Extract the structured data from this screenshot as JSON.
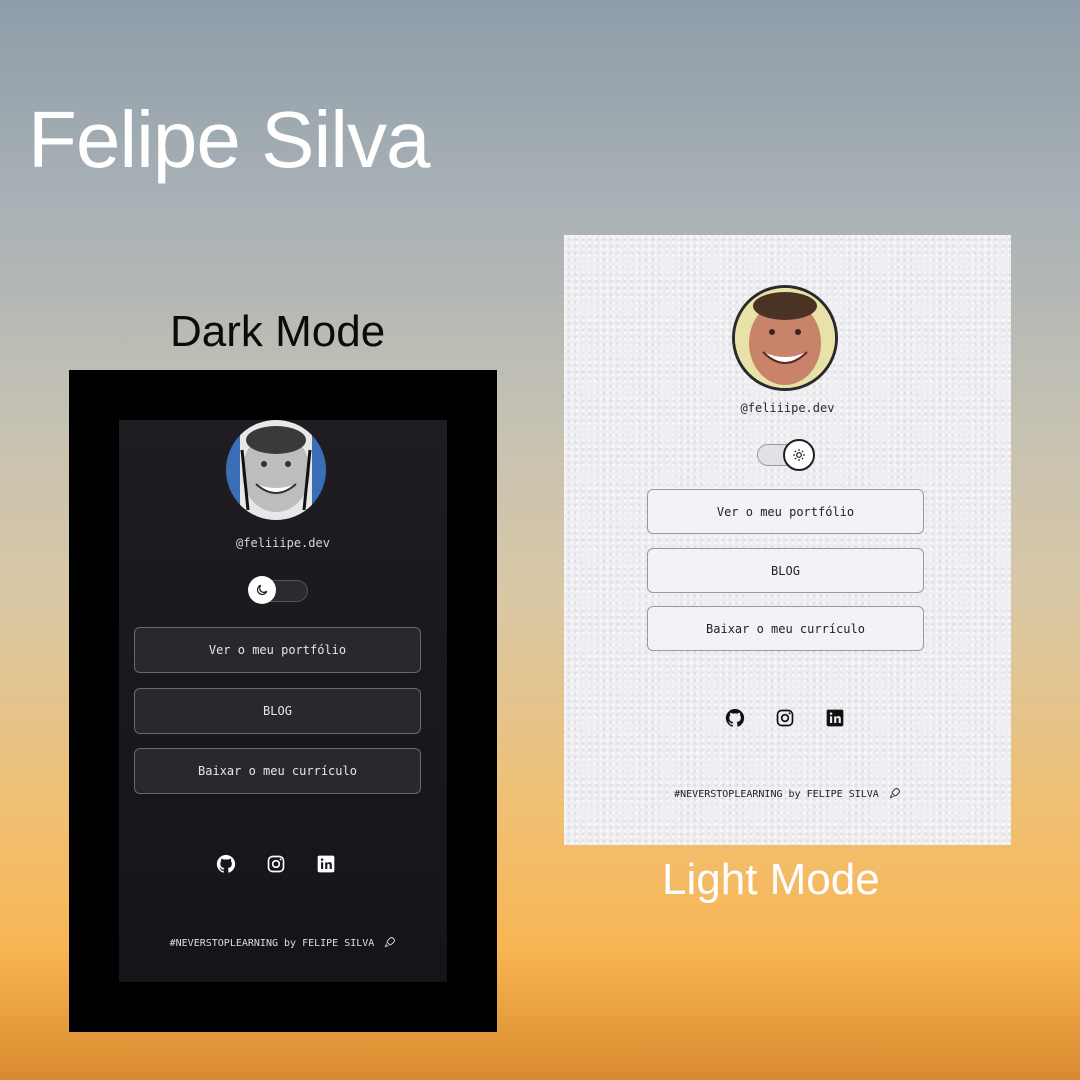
{
  "title": "Felipe Silva",
  "labels": {
    "dark": "Dark Mode",
    "light": "Light Mode"
  },
  "profile": {
    "handle": "@feliiipe.dev"
  },
  "buttons": {
    "portfolio": "Ver o meu portfólio",
    "blog": "BLOG",
    "resume": "Baixar o meu currículo"
  },
  "footer": "#NEVERSTOPLEARNING by FELIPE SILVA",
  "icons": [
    "github-icon",
    "instagram-icon",
    "linkedin-icon",
    "rocket-icon",
    "moon-icon",
    "sun-icon"
  ],
  "colors": {
    "dark_bg": "#1c1a1f",
    "light_bg": "#eeedf1",
    "accent_orange": "#f8b553"
  }
}
